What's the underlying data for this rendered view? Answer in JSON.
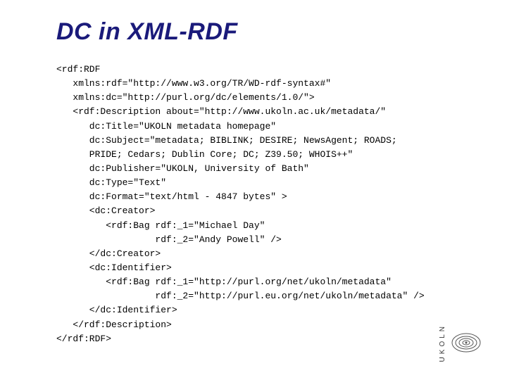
{
  "title": "DC in XML-RDF",
  "code": "<rdf:RDF\n   xmlns:rdf=\"http://www.w3.org/TR/WD-rdf-syntax#\"\n   xmlns:dc=\"http://purl.org/dc/elements/1.0/\">\n   <rdf:Description about=\"http://www.ukoln.ac.uk/metadata/\"\n      dc:Title=\"UKOLN metadata homepage\"\n      dc:Subject=\"metadata; BIBLINK; DESIRE; NewsAgent; ROADS;\n      PRIDE; Cedars; Dublin Core; DC; Z39.50; WHOIS++\"\n      dc:Publisher=\"UKOLN, University of Bath\"\n      dc:Type=\"Text\"\n      dc:Format=\"text/html - 4847 bytes\" >\n      <dc:Creator>\n         <rdf:Bag rdf:_1=\"Michael Day\"\n                  rdf:_2=\"Andy Powell\" />\n      </dc:Creator>\n      <dc:Identifier>\n         <rdf:Bag rdf:_1=\"http://purl.org/net/ukoln/metadata\"\n                  rdf:_2=\"http://purl.eu.org/net/ukoln/metadata\" />\n      </dc:Identifier>\n   </rdf:Description>\n</rdf:RDF>",
  "logo_text": "UKOLN"
}
